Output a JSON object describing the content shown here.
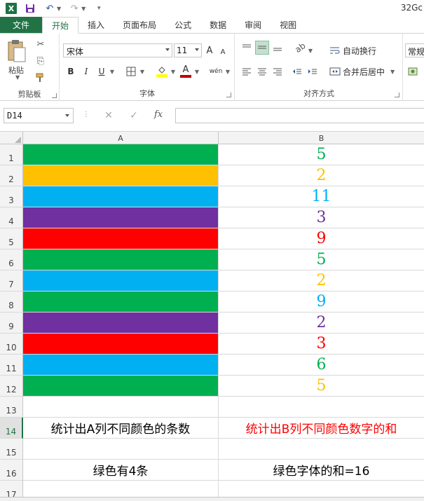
{
  "app": {
    "logo_text": "X",
    "title_partial": "32Gc"
  },
  "tabs": [
    {
      "label": "文件"
    },
    {
      "label": "开始"
    },
    {
      "label": "插入"
    },
    {
      "label": "页面布局"
    },
    {
      "label": "公式"
    },
    {
      "label": "数据"
    },
    {
      "label": "审阅"
    },
    {
      "label": "视图"
    }
  ],
  "ribbon": {
    "clipboard": {
      "paste_label": "粘贴",
      "group_label": "剪贴板"
    },
    "font": {
      "font_name": "宋体",
      "font_size": "11",
      "bold": "B",
      "italic": "I",
      "underline": "U",
      "grow": "A",
      "shrink": "A",
      "wen": "wén",
      "group_label": "字体",
      "fill_color": "#ffff00",
      "font_color": "#c00000"
    },
    "alignment": {
      "wrap_label": "自动换行",
      "merge_label": "合并后居中",
      "group_label": "对齐方式"
    },
    "number": {
      "format_label": "常规"
    }
  },
  "formula_bar": {
    "name_box": "D14",
    "fx": "fx",
    "formula": ""
  },
  "columns": [
    {
      "label": "A"
    },
    {
      "label": "B"
    }
  ],
  "rows": [
    {
      "num": "1",
      "fill": "#00b050",
      "value": "5",
      "color": "#00b050"
    },
    {
      "num": "2",
      "fill": "#ffc000",
      "value": "2",
      "color": "#ffc000"
    },
    {
      "num": "3",
      "fill": "#00b0f0",
      "value": "11",
      "color": "#00b0f0"
    },
    {
      "num": "4",
      "fill": "#7030a0",
      "value": "3",
      "color": "#7030a0"
    },
    {
      "num": "5",
      "fill": "#ff0000",
      "value": "9",
      "color": "#ff0000"
    },
    {
      "num": "6",
      "fill": "#00b050",
      "value": "5",
      "color": "#00b050"
    },
    {
      "num": "7",
      "fill": "#00b0f0",
      "value": "2",
      "color": "#ffc000"
    },
    {
      "num": "8",
      "fill": "#00b050",
      "value": "9",
      "color": "#00b0f0"
    },
    {
      "num": "9",
      "fill": "#7030a0",
      "value": "2",
      "color": "#7030a0"
    },
    {
      "num": "10",
      "fill": "#ff0000",
      "value": "3",
      "color": "#ff0000"
    },
    {
      "num": "11",
      "fill": "#00b0f0",
      "value": "6",
      "color": "#00b050"
    },
    {
      "num": "12",
      "fill": "#00b050",
      "value": "5",
      "color": "#ffc000"
    }
  ],
  "text_rows": [
    {
      "num": "13",
      "a": "",
      "b": "",
      "b_color": "#000000"
    },
    {
      "num": "14",
      "a": "统计出A列不同颜色的条数",
      "b": "统计出B列不同颜色数字的和",
      "b_color": "#ff0000",
      "selected": true
    },
    {
      "num": "15",
      "a": "",
      "b": "",
      "b_color": "#000000"
    },
    {
      "num": "16",
      "a": "绿色有4条",
      "b": "绿色字体的和=16",
      "b_color": "#000000"
    },
    {
      "num": "17",
      "a": "",
      "b": "",
      "b_color": "#000000"
    }
  ]
}
